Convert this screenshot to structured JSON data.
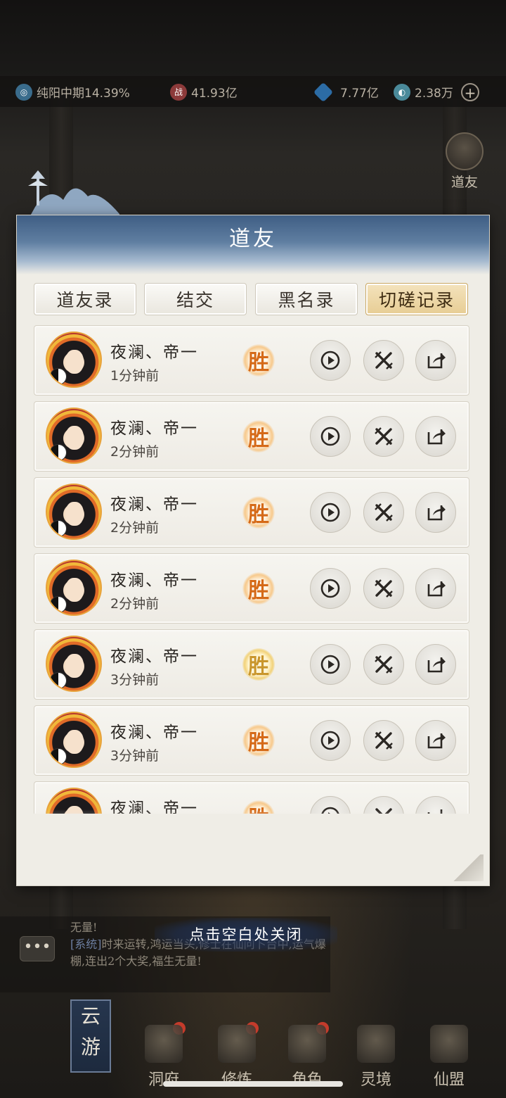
{
  "status": {
    "realm": "纯阳中期14.39%",
    "power": "41.93亿",
    "gems": "7.77亿",
    "coins": "2.38万",
    "power_icon_text": "战"
  },
  "side_shortcut": {
    "label": "道友"
  },
  "dialog": {
    "title": "道友",
    "tabs": [
      {
        "label": "道友录",
        "active": false
      },
      {
        "label": "结交",
        "active": false
      },
      {
        "label": "黑名录",
        "active": false
      },
      {
        "label": "切磋记录",
        "active": true
      }
    ],
    "records": [
      {
        "name": "夜澜、帝一",
        "time": "1分钟前",
        "result": "胜"
      },
      {
        "name": "夜澜、帝一",
        "time": "2分钟前",
        "result": "胜"
      },
      {
        "name": "夜澜、帝一",
        "time": "2分钟前",
        "result": "胜"
      },
      {
        "name": "夜澜、帝一",
        "time": "2分钟前",
        "result": "胜"
      },
      {
        "name": "夜澜、帝一",
        "time": "3分钟前",
        "result": "胜"
      },
      {
        "name": "夜澜、帝一",
        "time": "3分钟前",
        "result": "胜"
      },
      {
        "name": "夜澜、帝一",
        "time": "",
        "result": "胜"
      }
    ]
  },
  "close_hint": "点击空白处关闭",
  "chat": {
    "line1": "无量!",
    "system_tag": "[系统]",
    "line2": "时来运转,鸿运当头,修士在仙问卜台中,运气爆棚,连出2个大奖,福生无量!"
  },
  "cloud_tab": "云游",
  "nav": [
    {
      "label": "洞府"
    },
    {
      "label": "修炼"
    },
    {
      "label": "角色"
    },
    {
      "label": "灵境"
    },
    {
      "label": "仙盟"
    }
  ]
}
